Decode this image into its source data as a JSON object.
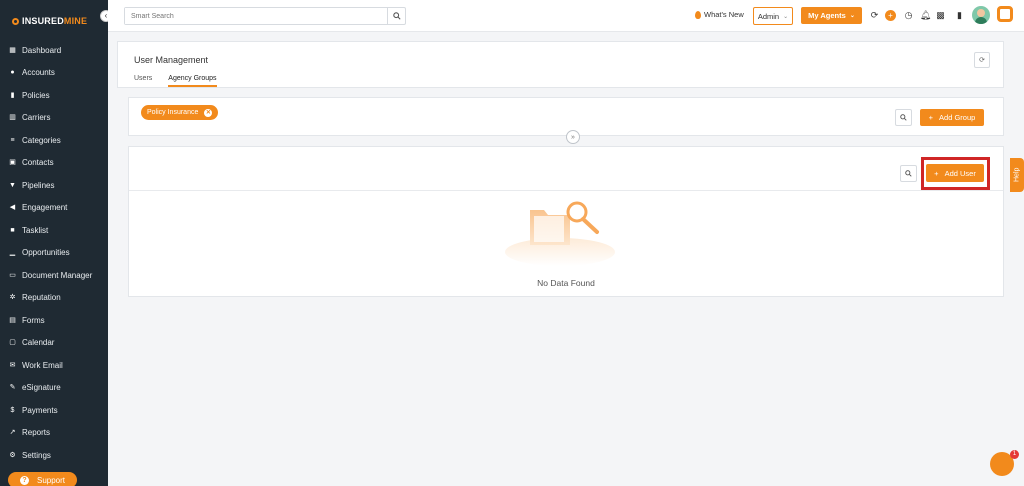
{
  "app": {
    "brand_a": "INSURED",
    "brand_b": "MINE",
    "accent_color": "#f28a1c"
  },
  "sidebar": {
    "items": [
      {
        "label": "Dashboard",
        "icon": "dashboard-icon"
      },
      {
        "label": "Accounts",
        "icon": "accounts-icon"
      },
      {
        "label": "Policies",
        "icon": "policies-icon"
      },
      {
        "label": "Carriers",
        "icon": "carriers-icon"
      },
      {
        "label": "Categories",
        "icon": "categories-icon"
      },
      {
        "label": "Contacts",
        "icon": "contacts-icon"
      },
      {
        "label": "Pipelines",
        "icon": "pipelines-icon"
      },
      {
        "label": "Engagement",
        "icon": "engagement-icon"
      },
      {
        "label": "Tasklist",
        "icon": "tasklist-icon"
      },
      {
        "label": "Opportunities",
        "icon": "opportunities-icon"
      },
      {
        "label": "Document Manager",
        "icon": "folder-icon"
      },
      {
        "label": "Reputation",
        "icon": "reputation-icon"
      },
      {
        "label": "Forms",
        "icon": "forms-icon"
      },
      {
        "label": "Calendar",
        "icon": "calendar-icon"
      },
      {
        "label": "Work Email",
        "icon": "email-icon"
      },
      {
        "label": "eSignature",
        "icon": "signature-icon"
      },
      {
        "label": "Payments",
        "icon": "payments-icon"
      },
      {
        "label": "Reports",
        "icon": "reports-icon"
      },
      {
        "label": "Settings",
        "icon": "settings-icon"
      }
    ],
    "support_label": "Support"
  },
  "topbar": {
    "search_placeholder": "Smart Search",
    "whats_new": "What's New",
    "admin_label": "Admin",
    "agents_label": "My Agents"
  },
  "user_management": {
    "title": "User Management",
    "tabs": [
      "Users",
      "Agency Groups"
    ],
    "active_tab": "Agency Groups"
  },
  "groups": {
    "chip_label": "Policy Insurance",
    "add_group_label": "Add Group"
  },
  "users": {
    "add_user_label": "Add User",
    "empty_text": "No Data Found"
  },
  "help_label": "Help",
  "chat_badge": "1"
}
